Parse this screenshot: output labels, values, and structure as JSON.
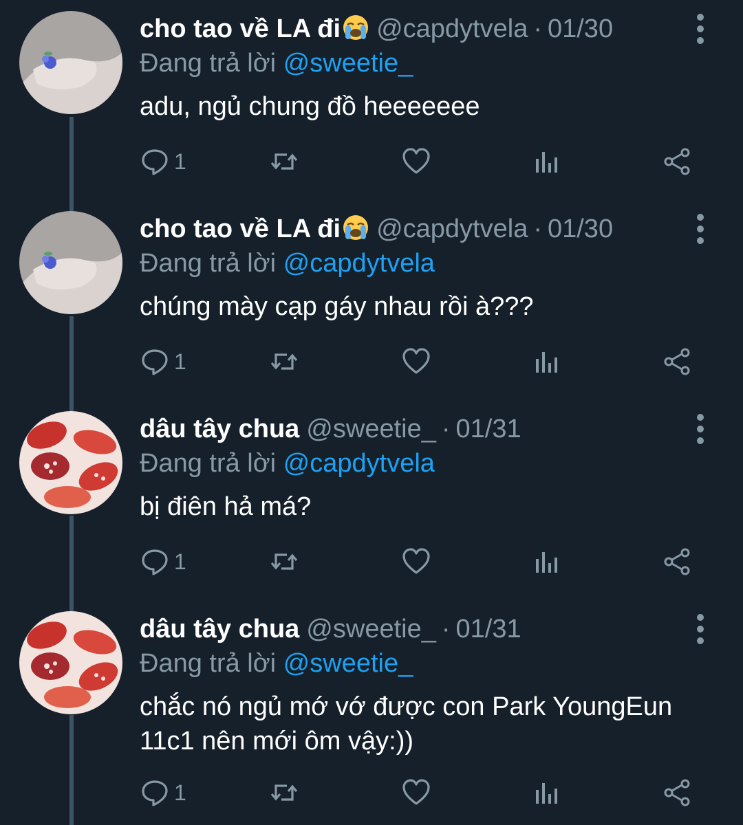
{
  "reply_prefix": "Đang trả lời",
  "separator": "·",
  "tweets": [
    {
      "name": "cho tao về LA đi",
      "emoji": "loudly-crying-face",
      "handle": "@capdytvela",
      "date": "01/30",
      "reply_to": "@sweetie_",
      "text": "adu, ngủ chung đồ heeeeeee",
      "reply_count": "1",
      "avatar": "ring-hand-avatar"
    },
    {
      "name": "cho tao về LA đi",
      "emoji": "loudly-crying-face",
      "handle": "@capdytvela",
      "date": "01/30",
      "reply_to": "@capdytvela",
      "text": "chúng mày cạp gáy nhau rồi à???",
      "reply_count": "1",
      "avatar": "ring-hand-avatar"
    },
    {
      "name": "dâu tây chua",
      "emoji": "",
      "handle": "@sweetie_",
      "date": "01/31",
      "reply_to": "@capdytvela",
      "text": "bị điên hả má?",
      "reply_count": "1",
      "avatar": "strawberry-milk-avatar"
    },
    {
      "name": "dâu tây chua",
      "emoji": "",
      "handle": "@sweetie_",
      "date": "01/31",
      "reply_to": "@sweetie_",
      "text": "chắc nó ngủ mớ vớ được con Park YoungEun 11c1 nên mới ôm vậy:))",
      "reply_count": "1",
      "avatar": "strawberry-milk-avatar"
    }
  ],
  "colors": {
    "background": "#15202b",
    "secondary_text": "#8899a6",
    "mention": "#1da1f2",
    "thread_line": "#3d5466"
  }
}
